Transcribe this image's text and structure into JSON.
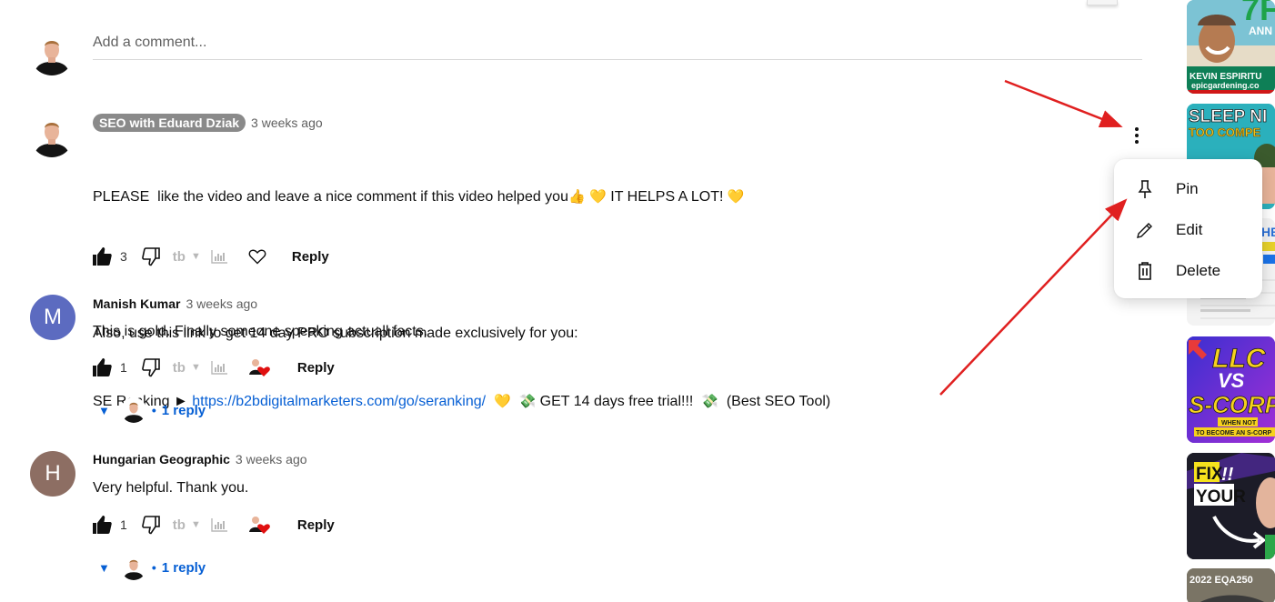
{
  "add_comment": {
    "placeholder": "Add a comment..."
  },
  "comments": [
    {
      "author": "SEO with Eduard Dziak",
      "is_channel_owner": true,
      "time": "3 weeks ago",
      "lines": {
        "line1": "PLEASE  like the video and leave a nice comment if this video helped you",
        "line1_emoji1": "👍",
        "line1_emoji2": "💛",
        "line1_tail": "IT HELPS A LOT!",
        "line1_emoji3": "💛",
        "line2": "Also, use this link to get 14 day PRO subscription made exclusively for you:",
        "line3_prefix": "SE Ranking ►",
        "line3_link": "https://b2bdigitalmarketers.com/go/seranking/",
        "line3_emoji1": "💛",
        "line3_emoji2": "💸",
        "line3_mid": "GET 14 days free trial!!!",
        "line3_emoji3": "💸",
        "line3_tail": "(Best SEO Tool)"
      },
      "likes": "3",
      "reply_label": "Reply",
      "heart": "heart-outline-icon"
    },
    {
      "author": "Manish Kumar",
      "avatar_letter": "M",
      "avatar_color": "#5c6bc0",
      "time": "3 weeks ago",
      "text": "This is gold. Finally someone speaking actuall facts.",
      "likes": "1",
      "reply_label": "Reply",
      "heart": "creator-heart-icon",
      "replies_label": "1 reply"
    },
    {
      "author": "Hungarian Geographic",
      "avatar_letter": "H",
      "avatar_color": "#8d6e63",
      "time": "3 weeks ago",
      "text": "Very helpful. Thank you.",
      "likes": "1",
      "reply_label": "Reply",
      "heart": "creator-heart-icon",
      "replies_label": "1 reply"
    }
  ],
  "context_menu": {
    "items": [
      {
        "label": "Pin",
        "icon": "pin-icon"
      },
      {
        "label": "Edit",
        "icon": "pencil-icon"
      },
      {
        "label": "Delete",
        "icon": "trash-icon"
      }
    ]
  },
  "sidebar_thumbnails": [
    {
      "title_text": "7F",
      "sub_text": "ANN",
      "caption": "KEVIN ESPIRITU",
      "caption2": "epicgardening.co"
    },
    {
      "title_text": "SLEEP NI",
      "sub_text": "TOO COMPE"
    },
    {
      "title_text": "HE"
    },
    {
      "title_text": "LLC",
      "sub_text": "VS",
      "sub_text2": "S-CORP",
      "caption": "WHEN NOT",
      "caption2": "TO BECOME AN S-CORP"
    },
    {
      "title_text": "FIX",
      "sub_text": "!!",
      "sub_text2": "YOUR"
    },
    {
      "title_text": "2022 EQA250"
    }
  ],
  "colors": {
    "link": "#065fd4",
    "annotation_arrow": "#e02020",
    "owner_badge": "#8a8a8a"
  }
}
